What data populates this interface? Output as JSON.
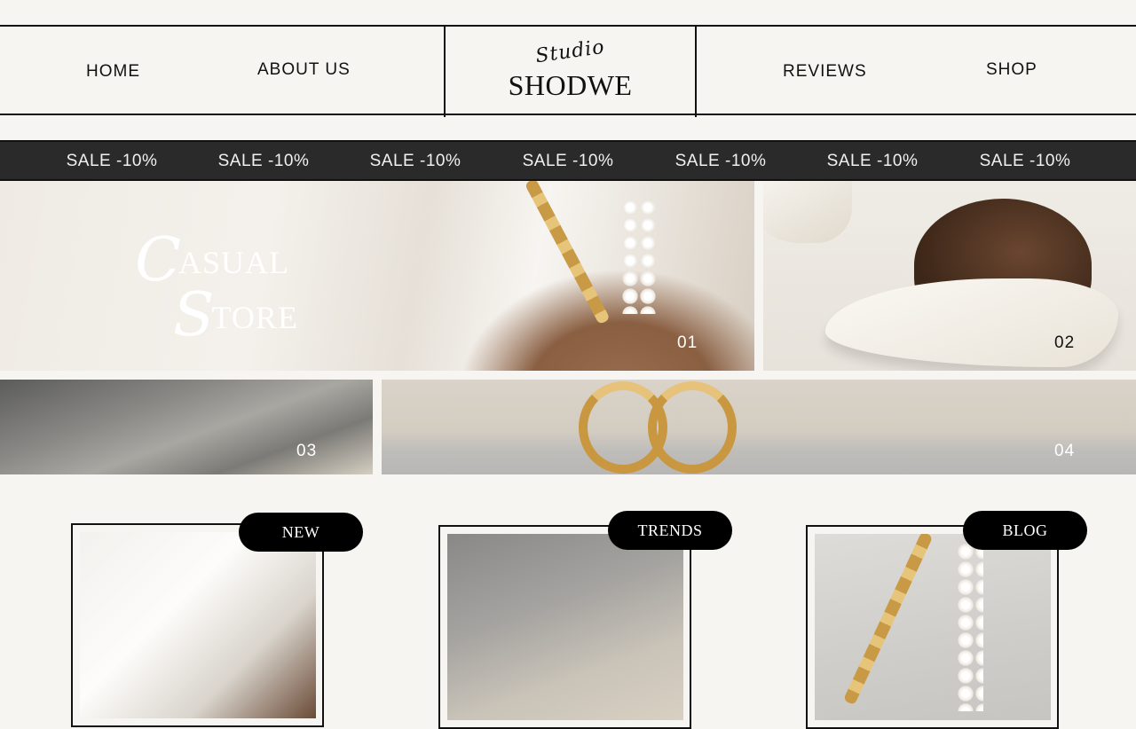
{
  "nav": {
    "home": "HOME",
    "about": "ABOUT US",
    "reviews": "REVIEWS",
    "shop": "SHOP"
  },
  "logo": {
    "script": "Studio",
    "name": "SHODWE"
  },
  "ribbon": {
    "items": [
      "SALE -10%",
      "SALE -10%",
      "SALE -10%",
      "SALE -10%",
      "SALE -10%",
      "SALE -10%",
      "SALE -10%"
    ]
  },
  "hero": {
    "line1_cap": "C",
    "line1_rest": "ASUAL",
    "line2_cap": "S",
    "line2_rest": "TORE"
  },
  "tiles": [
    {
      "number": "01"
    },
    {
      "number": "02"
    },
    {
      "number": "03"
    },
    {
      "number": "04"
    }
  ],
  "cards": [
    {
      "badge": "NEW"
    },
    {
      "badge": "TRENDS"
    },
    {
      "badge": "BLOG"
    }
  ],
  "colors": {
    "background": "#f6f5f1",
    "ribbon": "#2a2a2a",
    "badge": "#000000",
    "text": "#111111"
  }
}
